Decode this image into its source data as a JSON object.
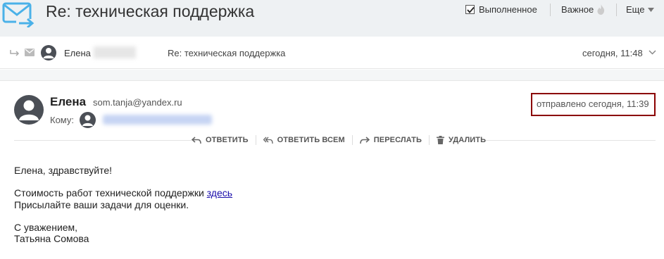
{
  "header": {
    "subject": "Re: техническая поддержка",
    "done_label": "Выполненное",
    "important_label": "Важное",
    "more_label": "Еще"
  },
  "thread": {
    "sender": "Елена",
    "subject": "Re: техническая поддержка",
    "time": "сегодня, 11:48"
  },
  "message": {
    "from_name": "Елена",
    "from_email": "som.tanja@yandex.ru",
    "to_label": "Кому:",
    "sent": "отправлено сегодня, 11:39",
    "actions": {
      "reply": "ОТВЕТИТЬ",
      "reply_all": "ОТВЕТИТЬ ВСЕМ",
      "forward": "ПЕРЕСЛАТЬ",
      "delete": "УДАЛИТЬ"
    },
    "body": {
      "greeting": "Елена, здравствуйте!",
      "line1_prefix": "Стоимость работ технической поддержки ",
      "line1_link": "здесь",
      "line2": "Присылайте ваши задачи для оценки.",
      "sign1": "С уважением,",
      "sign2": "Татьяна Сомова"
    }
  },
  "colors": {
    "logo_blue": "#4ab1e8",
    "avatar": "#4b4f56",
    "highlight_border": "#8b0000",
    "link": "#1a0dab"
  }
}
